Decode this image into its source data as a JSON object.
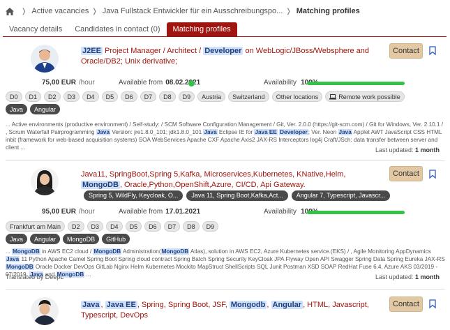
{
  "breadcrumb": {
    "home_icon": "home-icon",
    "items": [
      "Active vacancies",
      "Java Fullstack Entwickler für ein Ausschreibungspo...",
      "Matching profiles"
    ]
  },
  "tabs": [
    "Vacancy details",
    "Candidates in contact (0)",
    "Matching profiles"
  ],
  "active_tab": "Matching profiles",
  "colors": {
    "brand": "#a0150f",
    "contact_button": "#e2c9a3",
    "highlight": "#cfe0fb",
    "available": "#36c24a"
  },
  "contact_label": "Contact",
  "labels": {
    "rate_unit": "/hour",
    "available_from": "Available from",
    "availability": "Availability",
    "last_updated": "Last updated:",
    "translated": "Translated by DeepL"
  },
  "profiles": [
    {
      "title_parts": [
        "J2EE",
        " Project Manager / Architect / ",
        "Developer",
        " on WebLogic/JBoss/Websphere and Oracle/DB2; Unix derivative;"
      ],
      "rate": "75,00 EUR",
      "available_from": "08.02.2021",
      "availability": "100%",
      "availability_fraction": 1.0,
      "locations": [
        "D0",
        "D1",
        "D2",
        "D3",
        "D4",
        "D5",
        "D6",
        "D7",
        "D8",
        "D9",
        "Austria",
        "Switzerland",
        "Other locations",
        "Remote work possible"
      ],
      "skills": [
        "Java",
        "Angular"
      ],
      "snippet": [
        "... Active environments (productive environment) / Self-study: / SCM Software Configuration Management / Git, Ver. 2.0.0 (https://git-scm.com) / Git for Windows, Ver. 2.10.1 / , Scrum Waterfall Pairprogramming ",
        "Java",
        " Version: jre1.8.0_101; jdk1.8.0_101 ",
        "Java",
        " Eclipse IE for ",
        "Java EE",
        " ",
        "Developer",
        "; Ver. Neon ",
        "Java",
        " Applet AWT JavaScript CSS HTML inbit (framework for web-based acquisition systems) SOA WebServices Apache CXF Apache Axis2 JAX-RS Interceptors log4j Craft/JSch: data transfer between server and client ..."
      ],
      "last_updated": "1 month"
    },
    {
      "title_parts": [
        "Java11, SpringBoot,Spring 5,Kafka, Microservices,Kubernetes, KNative,Helm, ",
        "MongoDB",
        ", Oracle,Python,OpenShift,Azure, CI/CD, Api Gateway."
      ],
      "tags": [
        "Spring 5, WildFly, Keycloak, O...",
        "Java 11, Spring Boot,Kafka,Act...",
        "Angular 7, Typescript, Javascr..."
      ],
      "rate": "95,00 EUR",
      "available_from": "17.01.2021",
      "availability": "100%",
      "availability_fraction": 1.0,
      "locations": [
        "Frankfurt am Main",
        "D2",
        "D3",
        "D4",
        "D5",
        "D6",
        "D7",
        "D8",
        "D9"
      ],
      "skills": [
        "Java",
        "Angular",
        "MongoDB",
        "GitHub"
      ],
      "snippet": [
        "... ",
        "MongoDB",
        " in AWS EC2 cloud / ",
        "MongoDB",
        " Administration(",
        "MongoDB",
        " Atlas), solution in AWS EC2, Azure Kubernetes service.(EKS) / , Agile Monitoring AppDynamics ",
        "Java",
        " 11 Python Apache Camel Spring Boot Spring cloud contract Spring Batch Spring Security KeyCloak JPA Flyway Open API Swagger Spring Data Spring Eureka JAX-RS ",
        "MongoDB",
        " Oracle Docker DevOps GitLab Nginx Helm Kubernetes Mockito MapStruct ShellScripts SQL Junit Postman XSD SOAP RedHat Fuse 6.4, Azure AKS 03/2019 - 07/2019, ",
        "Java",
        " and ",
        "MongoDB",
        " ..."
      ],
      "last_updated": "1 month"
    },
    {
      "title_parts": [
        "Java",
        ", ",
        "Java EE",
        ", Spring, Spring Boot, JSF, ",
        "Mongodb",
        ", ",
        "Angular",
        ", HTML, Javascript, Typescript, DevOps"
      ]
    }
  ]
}
